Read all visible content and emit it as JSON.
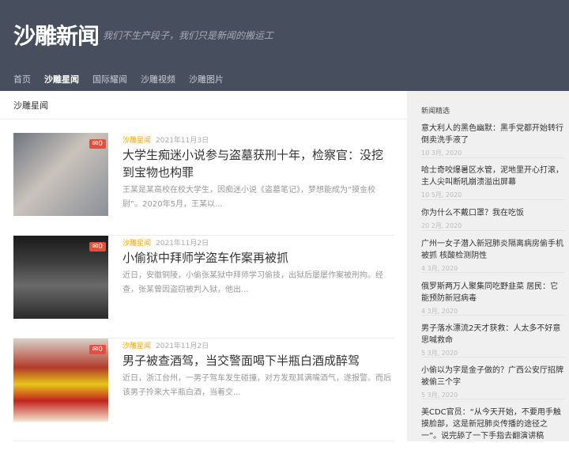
{
  "header": {
    "logo": "沙雕新闻",
    "tagline": "我们不生产段子，我们只是新闻的搬运工"
  },
  "nav": [
    "首页",
    "沙雕星闻",
    "国际耀闻",
    "沙雕视频",
    "沙雕图片"
  ],
  "section_title": "沙雕星闻",
  "articles": [
    {
      "category": "沙雕星闻",
      "date": "2021年11月3日",
      "comments": "0",
      "title": "大学生痴迷小说参与盗墓获刑十年，检察官：没挖到宝物也构罪",
      "excerpt": "王某是某高校在校大学生，因痴迷小说《盗墓笔记》，梦想能成为“摸金校尉”。2020年5月，王某以..."
    },
    {
      "category": "沙雕星闻",
      "date": "2021年11月2日",
      "comments": "0",
      "title": "小偷狱中拜师学盗车作案再被抓",
      "excerpt": "近日，安徽铜陵，小偷张某狱中拜师学习偷技，出狱后屡屡作案被刑拘。经查，张某曾因盗窃被判入狱，他出..."
    },
    {
      "category": "沙雕星闻",
      "date": "2021年11月2日",
      "comments": "0",
      "title": "男子被查酒驾，当交警面喝下半瓶白酒成醉驾",
      "excerpt": "近日，浙江台州，一男子驾车发生碰撞，对方发现其满嘴酒气，遂报警。而后该男子拎来大半瓶白酒，当着交..."
    }
  ],
  "sidebar": {
    "title": "新闻精选",
    "items": [
      {
        "title": "意大利人的黑色幽默：黑手党都开始转行倒卖洗手液了",
        "date": "10 3月, 2020"
      },
      {
        "title": "哈士奇咬爆暑区水管，泥地里开心打滚，主人尖叫断吼崩溃溢出屏幕",
        "date": "10 5月, 2020"
      },
      {
        "title": "你为什么不戴口罩？我在吃饭",
        "date": "20 2月, 2020"
      },
      {
        "title": "广州一女子潜入新冠肺炎隔离病房偷手机被抓 核酸检测阴性",
        "date": "4 3月, 2020"
      },
      {
        "title": "俄罗斯两万人聚集同吃野韭菜 居民：它能预防新冠病毒",
        "date": "4 3月, 2020"
      },
      {
        "title": "男子落水漂流2天才获救：人太多不好意思喊救命",
        "date": "5 3月, 2020"
      },
      {
        "title": "小偷以为字是金子做的？广西公安厅招牌被偷三个字",
        "date": "5 3月, 2020"
      },
      {
        "title": "美CDC官员：“从今天开始，不要用手触摸脸部，这是新冠肺炎传播的途径之一”。说完舔了一下手指去翻演讲稿",
        "date": ""
      }
    ]
  }
}
